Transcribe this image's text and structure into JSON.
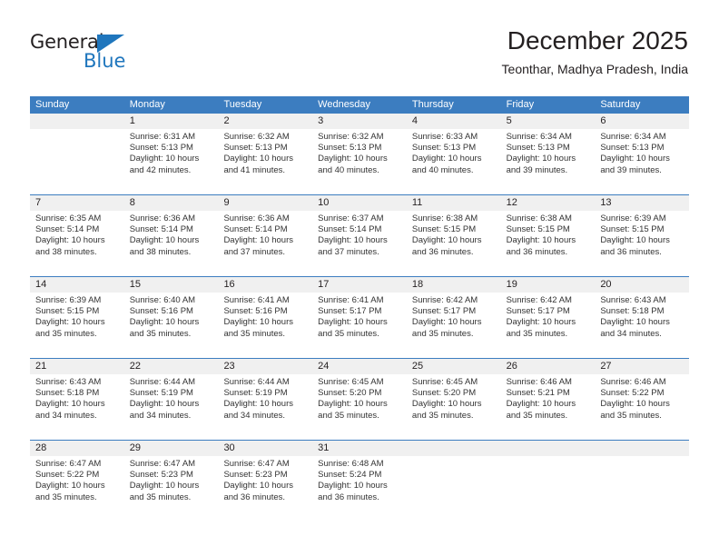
{
  "brand": {
    "name_part1": "General",
    "name_part2": "Blue",
    "accent_color": "#1f76bd"
  },
  "header": {
    "title": "December 2025",
    "subtitle": "Teonthar, Madhya Pradesh, India"
  },
  "theme": {
    "header_blue": "#3c7dc0",
    "day_number_bg": "#f0f0f0",
    "text_color": "#231f20"
  },
  "weekdays": [
    "Sunday",
    "Monday",
    "Tuesday",
    "Wednesday",
    "Thursday",
    "Friday",
    "Saturday"
  ],
  "weeks": [
    [
      {
        "day": "",
        "sunrise": "",
        "sunset": "",
        "daylight_line1": "",
        "daylight_line2": ""
      },
      {
        "day": "1",
        "sunrise": "Sunrise: 6:31 AM",
        "sunset": "Sunset: 5:13 PM",
        "daylight_line1": "Daylight: 10 hours",
        "daylight_line2": "and 42 minutes."
      },
      {
        "day": "2",
        "sunrise": "Sunrise: 6:32 AM",
        "sunset": "Sunset: 5:13 PM",
        "daylight_line1": "Daylight: 10 hours",
        "daylight_line2": "and 41 minutes."
      },
      {
        "day": "3",
        "sunrise": "Sunrise: 6:32 AM",
        "sunset": "Sunset: 5:13 PM",
        "daylight_line1": "Daylight: 10 hours",
        "daylight_line2": "and 40 minutes."
      },
      {
        "day": "4",
        "sunrise": "Sunrise: 6:33 AM",
        "sunset": "Sunset: 5:13 PM",
        "daylight_line1": "Daylight: 10 hours",
        "daylight_line2": "and 40 minutes."
      },
      {
        "day": "5",
        "sunrise": "Sunrise: 6:34 AM",
        "sunset": "Sunset: 5:13 PM",
        "daylight_line1": "Daylight: 10 hours",
        "daylight_line2": "and 39 minutes."
      },
      {
        "day": "6",
        "sunrise": "Sunrise: 6:34 AM",
        "sunset": "Sunset: 5:13 PM",
        "daylight_line1": "Daylight: 10 hours",
        "daylight_line2": "and 39 minutes."
      }
    ],
    [
      {
        "day": "7",
        "sunrise": "Sunrise: 6:35 AM",
        "sunset": "Sunset: 5:14 PM",
        "daylight_line1": "Daylight: 10 hours",
        "daylight_line2": "and 38 minutes."
      },
      {
        "day": "8",
        "sunrise": "Sunrise: 6:36 AM",
        "sunset": "Sunset: 5:14 PM",
        "daylight_line1": "Daylight: 10 hours",
        "daylight_line2": "and 38 minutes."
      },
      {
        "day": "9",
        "sunrise": "Sunrise: 6:36 AM",
        "sunset": "Sunset: 5:14 PM",
        "daylight_line1": "Daylight: 10 hours",
        "daylight_line2": "and 37 minutes."
      },
      {
        "day": "10",
        "sunrise": "Sunrise: 6:37 AM",
        "sunset": "Sunset: 5:14 PM",
        "daylight_line1": "Daylight: 10 hours",
        "daylight_line2": "and 37 minutes."
      },
      {
        "day": "11",
        "sunrise": "Sunrise: 6:38 AM",
        "sunset": "Sunset: 5:15 PM",
        "daylight_line1": "Daylight: 10 hours",
        "daylight_line2": "and 36 minutes."
      },
      {
        "day": "12",
        "sunrise": "Sunrise: 6:38 AM",
        "sunset": "Sunset: 5:15 PM",
        "daylight_line1": "Daylight: 10 hours",
        "daylight_line2": "and 36 minutes."
      },
      {
        "day": "13",
        "sunrise": "Sunrise: 6:39 AM",
        "sunset": "Sunset: 5:15 PM",
        "daylight_line1": "Daylight: 10 hours",
        "daylight_line2": "and 36 minutes."
      }
    ],
    [
      {
        "day": "14",
        "sunrise": "Sunrise: 6:39 AM",
        "sunset": "Sunset: 5:15 PM",
        "daylight_line1": "Daylight: 10 hours",
        "daylight_line2": "and 35 minutes."
      },
      {
        "day": "15",
        "sunrise": "Sunrise: 6:40 AM",
        "sunset": "Sunset: 5:16 PM",
        "daylight_line1": "Daylight: 10 hours",
        "daylight_line2": "and 35 minutes."
      },
      {
        "day": "16",
        "sunrise": "Sunrise: 6:41 AM",
        "sunset": "Sunset: 5:16 PM",
        "daylight_line1": "Daylight: 10 hours",
        "daylight_line2": "and 35 minutes."
      },
      {
        "day": "17",
        "sunrise": "Sunrise: 6:41 AM",
        "sunset": "Sunset: 5:17 PM",
        "daylight_line1": "Daylight: 10 hours",
        "daylight_line2": "and 35 minutes."
      },
      {
        "day": "18",
        "sunrise": "Sunrise: 6:42 AM",
        "sunset": "Sunset: 5:17 PM",
        "daylight_line1": "Daylight: 10 hours",
        "daylight_line2": "and 35 minutes."
      },
      {
        "day": "19",
        "sunrise": "Sunrise: 6:42 AM",
        "sunset": "Sunset: 5:17 PM",
        "daylight_line1": "Daylight: 10 hours",
        "daylight_line2": "and 35 minutes."
      },
      {
        "day": "20",
        "sunrise": "Sunrise: 6:43 AM",
        "sunset": "Sunset: 5:18 PM",
        "daylight_line1": "Daylight: 10 hours",
        "daylight_line2": "and 34 minutes."
      }
    ],
    [
      {
        "day": "21",
        "sunrise": "Sunrise: 6:43 AM",
        "sunset": "Sunset: 5:18 PM",
        "daylight_line1": "Daylight: 10 hours",
        "daylight_line2": "and 34 minutes."
      },
      {
        "day": "22",
        "sunrise": "Sunrise: 6:44 AM",
        "sunset": "Sunset: 5:19 PM",
        "daylight_line1": "Daylight: 10 hours",
        "daylight_line2": "and 34 minutes."
      },
      {
        "day": "23",
        "sunrise": "Sunrise: 6:44 AM",
        "sunset": "Sunset: 5:19 PM",
        "daylight_line1": "Daylight: 10 hours",
        "daylight_line2": "and 34 minutes."
      },
      {
        "day": "24",
        "sunrise": "Sunrise: 6:45 AM",
        "sunset": "Sunset: 5:20 PM",
        "daylight_line1": "Daylight: 10 hours",
        "daylight_line2": "and 35 minutes."
      },
      {
        "day": "25",
        "sunrise": "Sunrise: 6:45 AM",
        "sunset": "Sunset: 5:20 PM",
        "daylight_line1": "Daylight: 10 hours",
        "daylight_line2": "and 35 minutes."
      },
      {
        "day": "26",
        "sunrise": "Sunrise: 6:46 AM",
        "sunset": "Sunset: 5:21 PM",
        "daylight_line1": "Daylight: 10 hours",
        "daylight_line2": "and 35 minutes."
      },
      {
        "day": "27",
        "sunrise": "Sunrise: 6:46 AM",
        "sunset": "Sunset: 5:22 PM",
        "daylight_line1": "Daylight: 10 hours",
        "daylight_line2": "and 35 minutes."
      }
    ],
    [
      {
        "day": "28",
        "sunrise": "Sunrise: 6:47 AM",
        "sunset": "Sunset: 5:22 PM",
        "daylight_line1": "Daylight: 10 hours",
        "daylight_line2": "and 35 minutes."
      },
      {
        "day": "29",
        "sunrise": "Sunrise: 6:47 AM",
        "sunset": "Sunset: 5:23 PM",
        "daylight_line1": "Daylight: 10 hours",
        "daylight_line2": "and 35 minutes."
      },
      {
        "day": "30",
        "sunrise": "Sunrise: 6:47 AM",
        "sunset": "Sunset: 5:23 PM",
        "daylight_line1": "Daylight: 10 hours",
        "daylight_line2": "and 36 minutes."
      },
      {
        "day": "31",
        "sunrise": "Sunrise: 6:48 AM",
        "sunset": "Sunset: 5:24 PM",
        "daylight_line1": "Daylight: 10 hours",
        "daylight_line2": "and 36 minutes."
      },
      {
        "day": "",
        "sunrise": "",
        "sunset": "",
        "daylight_line1": "",
        "daylight_line2": ""
      },
      {
        "day": "",
        "sunrise": "",
        "sunset": "",
        "daylight_line1": "",
        "daylight_line2": ""
      },
      {
        "day": "",
        "sunrise": "",
        "sunset": "",
        "daylight_line1": "",
        "daylight_line2": ""
      }
    ]
  ]
}
